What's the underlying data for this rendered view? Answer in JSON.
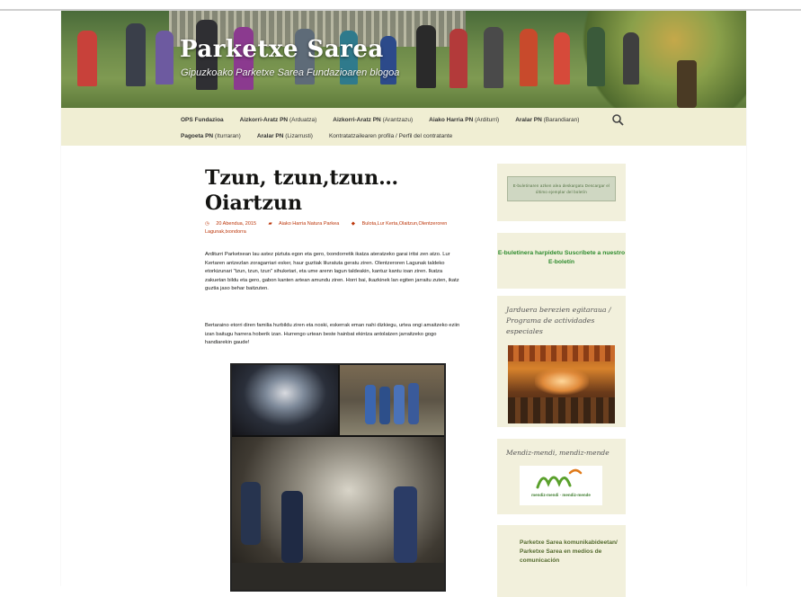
{
  "site": {
    "title": "Parketxe Sarea",
    "description": "Gipuzkoako Parketxe Sarea Fundazioaren blogoa"
  },
  "nav": {
    "row1": [
      {
        "bold": "OPS Fundazioa",
        "rest": ""
      },
      {
        "bold": "Aizkorri-Aratz PN",
        "rest": " (Arduatza)"
      },
      {
        "bold": "Aizkorri-Aratz PN",
        "rest": " (Arantzazu)"
      },
      {
        "bold": "Aiako Harria PN",
        "rest": " (Arditurri)"
      },
      {
        "bold": "Aralar PN",
        "rest": " (Barandiaran)"
      }
    ],
    "row2": [
      {
        "bold": "Pagoeta PN",
        "rest": " (Iturraran)"
      },
      {
        "bold": "Aralar PN",
        "rest": " (Lizarrusti)"
      },
      {
        "bold": "",
        "rest": "Kontratatzailearen profila / Perfil del contratante"
      }
    ]
  },
  "post": {
    "title": "Tzun, tzun,tzun… Oiartzun",
    "date": "20 Abendua, 2015",
    "category": "Aiako Harria Natura Parkea",
    "tags": "Bulota,Lur Kerta,Olaitzun,Olentzeroren Lagunak,txondorra",
    "paragraph1": "Arditurri Parketxean lau astez piztuta egon eta gero, txondorretik ikatza ateratzeko garai iritsi zen atzo. Lur Kertaren antzezlan zoragarriari esker, haur guztiak liluratuta geratu ziren. Olentzeroren Lagunak taldeko etorkizunari \"tzun, tzun, tzun\" sihuketari, eta ume arenn lagun taldeakin, kantuz kantu ioan ziren. Ikatza zakuetan bildu eta gero, gabon kanten artean amundu ziren. Horri bai, ikazkinek lan egiten jarraitu zuten, ikatz guztia jaso behar baitzuten.",
    "paragraph2": "Bertaraino etorri diren familia hurbildu ziren eta noski, eskerrak eman nahi dizkiegu, urtea ongi amaitzeko eziin izan baitugu harrera hoberik izan. Hurrengo urtean beste hainbat ekintza antolatzen jarraitzeko gogo handiarekin gaude!"
  },
  "sidebar": {
    "widget1_text": "E-buletinaren azken alea deskargatu Descargar el último ejemplar del boletín",
    "widget2_text": "E-buletinera harpidetu Suscríbete a nuestro E-boletín",
    "widget3_title": "Jarduera berezien egitaraua / Programa de actividades especiales",
    "widget4_title": "Mendiz-mendi, mendiz-mende",
    "widget4_logo": "mendiz-mendi · mendiz-mende",
    "widget5_text": "Parketxe Sarea komunikabideetan/ Parketxe Sarea en medios de comunicación"
  },
  "colors": {
    "nav_bg": "#f0eed3",
    "sidebar_bg": "#f2f0dc",
    "meta_link": "#bc360a",
    "green_link": "#2e8b2e"
  },
  "icons": [
    "search-icon",
    "clock-icon",
    "folder-icon",
    "tag-icon"
  ]
}
